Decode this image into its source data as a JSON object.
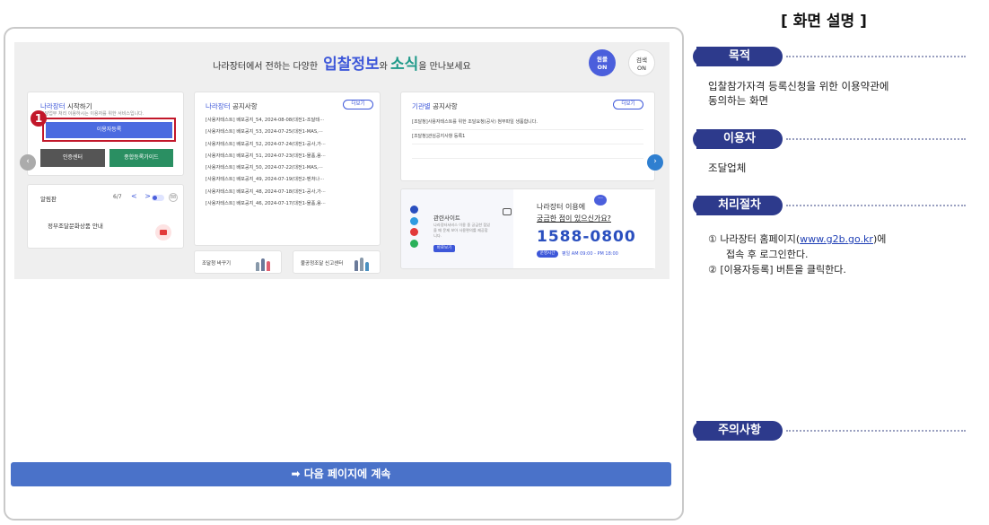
{
  "continue_label": "➡ 다음 페이지에 계속",
  "headline": {
    "pre": "나라장터에서 전하는 다양한",
    "hl1": "입찰정보",
    "mid": "와",
    "hl2": "소식",
    "post": "을 만나보세요"
  },
  "toggles": {
    "fav_l1": "원클",
    "fav_l2": "ON",
    "search_l1": "검색",
    "search_l2": "ON"
  },
  "start_card": {
    "title_brand": "나라장터",
    "title_rest": "시작하기",
    "subtitle": "조달업무 처리 이용하시는 이용자를 위한 서비스입니다.",
    "register_button": "이용자등록",
    "cert_button": "인증센터",
    "guide_button": "종합등록가이드",
    "step_number": "1"
  },
  "alarm_card": {
    "title": "알림판",
    "page": "6/7",
    "nav": "< >",
    "grid_icon": "88",
    "item": "정부조달문화상품 안내"
  },
  "notice_card": {
    "title_brand": "나라장터",
    "title_rest": "공지사항",
    "more": "더보기",
    "items": [
      "[사용자테스트] 배포공지_54, 2024-08-08(대전1-조달테···",
      "[사용자테스트] 배포공지_53, 2024-07-25(대전1-MAS,···",
      "[사용자테스트] 배포공지_52, 2024-07-24(대전1-공사,가···",
      "[사용자테스트] 배포공지_51, 2024-07-23(대전1-물품,용···",
      "[사용자테스트] 배포공지_50, 2024-07-22(대전1-MAS,···",
      "[사용자테스트] 배포공지_49, 2024-07-19(대전2-벤처나···",
      "[사용자테스트] 배포공지_48, 2024-07-18(대전1-공사,가···",
      "[사용자테스트] 배포공지_46, 2024-07-17(대전1-물품,용···"
    ]
  },
  "agency_card": {
    "title_brand": "기관별",
    "title_rest": "공지사항",
    "more": "더보기",
    "items": [
      "[조달청]사용자테스트를 위한 조달요청(공사) 첨부파일 생품합니다.",
      "[조달청]관심공지사항 등록1",
      ""
    ]
  },
  "arrows": {
    "left": "‹",
    "right": "›"
  },
  "sites_card": {
    "title": "관련사이트",
    "desc": "나라장터서비스 이용 중 궁금한 점있을 때 문제 보아 사용편의를 제공합니다.",
    "go_button": "바로보기"
  },
  "help_card": {
    "q1": "나라장터 이용에",
    "q2": "궁금한 점이 있으신가요?",
    "bubble": "···",
    "phone": "1588-0800",
    "hours_tag": "운영시간",
    "hours": "평일 AM 09:00 - PM 18:00"
  },
  "bottom_cards": {
    "first": "조달청 바꾸기",
    "second": "불공정조달 신고센터"
  },
  "panel": {
    "title": "[ 화면 설명 ]",
    "purpose_label": "목적",
    "purpose_text_1": "입찰참가자격 등록신청을 위한 이용약관에",
    "purpose_text_2": "동의하는 화면",
    "user_label": "이용자",
    "user_text": "조달업체",
    "procedure_label": "처리절차",
    "step1_pre": "① 나라장터 홈페이지(",
    "step1_link": "www.g2b.go.kr",
    "step1_post": ")에",
    "step1_cont": "접속 후 로그인한다.",
    "step2": "② [이용자등록] 버튼을 클릭한다.",
    "caution_label": "주의사항"
  }
}
